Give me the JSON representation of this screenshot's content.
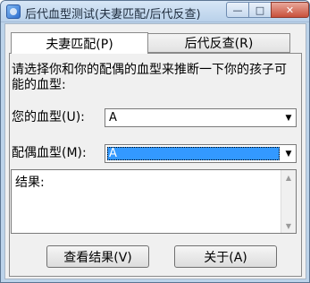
{
  "window": {
    "title": "后代血型测试(夫妻匹配/后代反查)",
    "icon": "app-icon",
    "controls": {
      "minimize": "—",
      "maximize": "□",
      "close": "✕"
    }
  },
  "tabs": [
    {
      "label": "夫妻匹配(P)",
      "active": true
    },
    {
      "label": "后代反查(R)",
      "active": false
    }
  ],
  "prompt": "请选择你和你的配偶的血型来推断一下你的孩子可能的血型:",
  "your_blood": {
    "label": "您的血型(U):",
    "value": "A"
  },
  "spouse_blood": {
    "label": "配偶血型(M):",
    "value": "A"
  },
  "result": {
    "text": "结果:"
  },
  "buttons": {
    "view": "查看结果(V)",
    "about": "关于(A)"
  },
  "icons": {
    "dropdown": "▼",
    "scroll_up": "▲",
    "scroll_down": "▼"
  },
  "colors": {
    "selection": "#3399ff",
    "close_button": "#c8503b"
  }
}
